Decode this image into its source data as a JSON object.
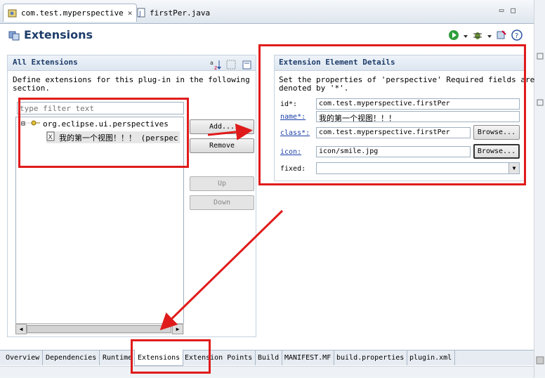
{
  "editor_tabs": [
    {
      "label": "com.test.myperspective",
      "icon": "plugin-manifest-icon",
      "close": "✕"
    },
    {
      "label": "firstPer.java",
      "icon": "java-file-icon"
    }
  ],
  "window_buttons": {
    "minimize": "▭",
    "maximize": "□"
  },
  "form": {
    "title": "Extensions"
  },
  "all_extensions": {
    "title": "All Extensions",
    "description_line1": "Define extensions for this plug-in in the following",
    "description_line2": "section.",
    "filter_placeholder": "type filter text",
    "tree": {
      "root": {
        "expander": "⊟",
        "label": "org.eclipse.ui.perspectives"
      },
      "child": {
        "label": "我的第一个视图！！！ (perspec"
      }
    },
    "buttons": {
      "add": "Add...",
      "remove": "Remove",
      "up": "Up",
      "down": "Down"
    }
  },
  "details": {
    "title": "Extension Element Details",
    "description_line1": "Set the properties of 'perspective' Required fields are",
    "description_line2": "denoted by '*'.",
    "fields": {
      "id": {
        "label": "id*:",
        "value": "com.test.myperspective.firstPer"
      },
      "name": {
        "label": "name*:",
        "value": "我的第一个视图！！！"
      },
      "class": {
        "label": "class*:",
        "value": "com.test.myperspective.firstPer",
        "browse": "Browse..."
      },
      "icon": {
        "label": "icon:",
        "value": "icon/smile.jpg",
        "browse": "Browse..."
      },
      "fixed": {
        "label": "fixed:",
        "value": ""
      }
    }
  },
  "page_tabs": [
    "Overview",
    "Dependencies",
    "Runtime",
    "Extensions",
    "Extension Points",
    "Build",
    "MANIFEST.MF",
    "build.properties",
    "plugin.xml"
  ],
  "active_page_tab": "Extensions",
  "colors": {
    "annotation": "#e01b1b",
    "title": "#1e3d6b",
    "link": "#1a3ea8"
  }
}
